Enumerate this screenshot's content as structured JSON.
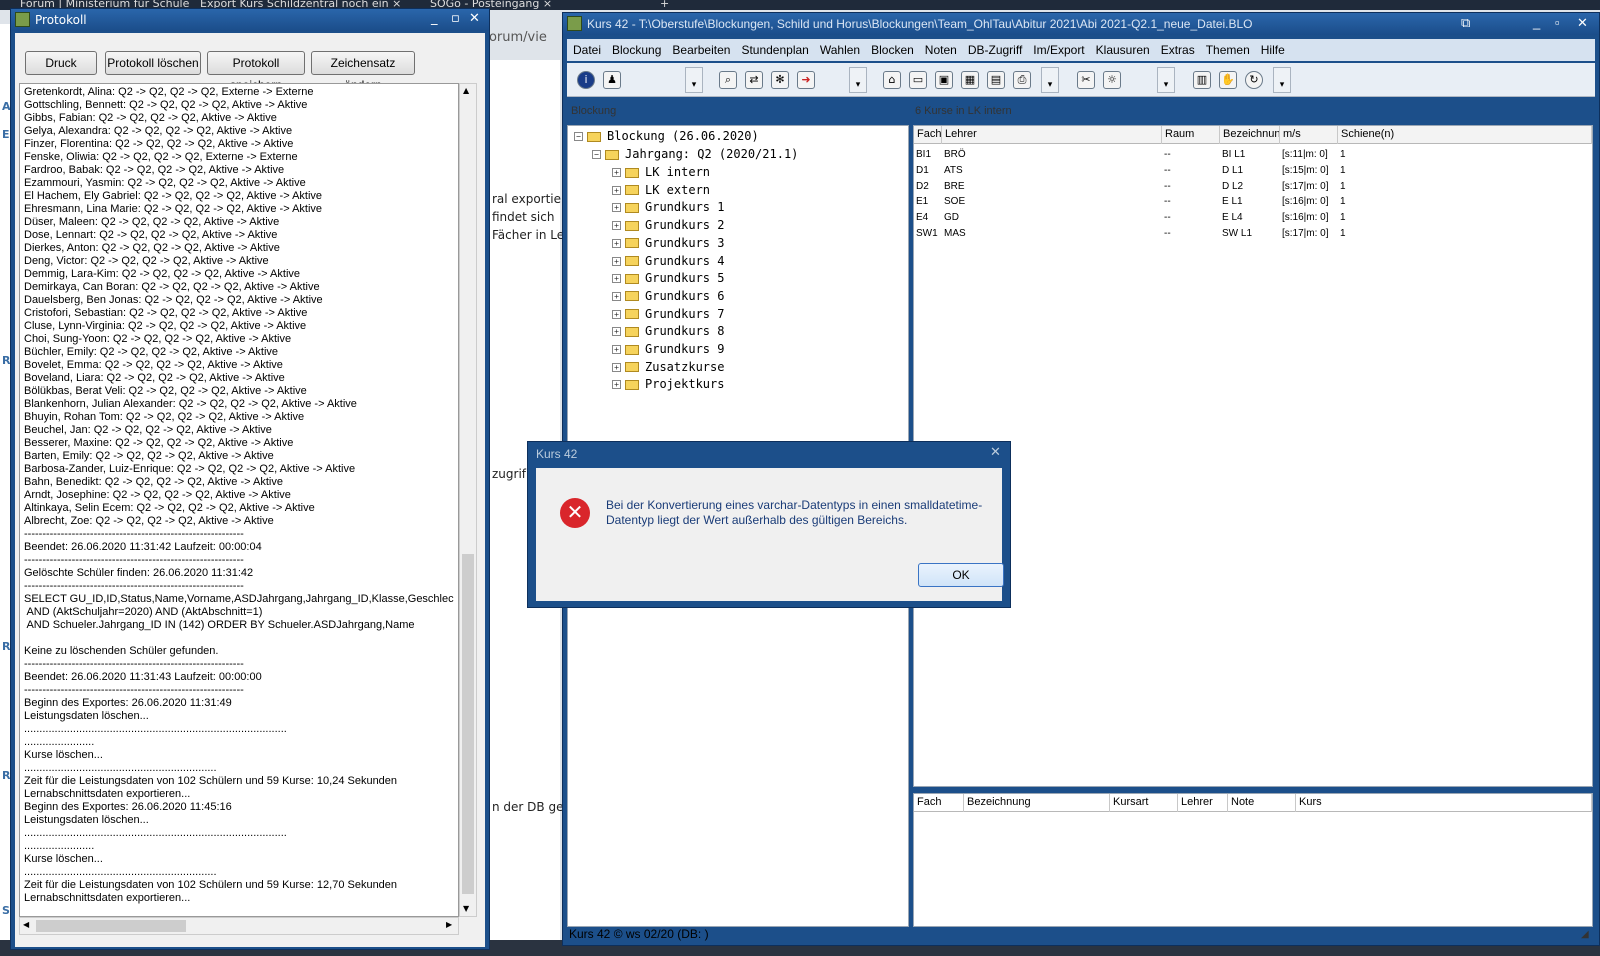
{
  "browser": {
    "tabs": [
      "Forum | Ministerium für Schule ×",
      "Export Kurs Schildzentral noch ein ×",
      "SOGo - Posteingang ×",
      "+"
    ],
    "address_fragment": "/forum/vie",
    "page_lines": [
      "ral exportie",
      "findet sich",
      "Fächer in Le",
      "zugrif",
      "n der DB ge"
    ],
    "left_letters": [
      "A",
      "E",
      "R",
      "R",
      "R",
      "S"
    ]
  },
  "protokoll": {
    "title": "Protokoll",
    "buttons": {
      "druck": "Druck",
      "loeschen": "Protokoll löschen",
      "speichern": "Protokoll speichern",
      "zeichensatz": "Zeichensatz ändern"
    },
    "lines": [
      "Gretenkordt, Alina: Q2 -> Q2, Q2 -> Q2, Externe -> Externe",
      "Gottschling, Bennett: Q2 -> Q2, Q2 -> Q2, Aktive -> Aktive",
      "Gibbs, Fabian: Q2 -> Q2, Q2 -> Q2, Aktive -> Aktive",
      "Gelya, Alexandra: Q2 -> Q2, Q2 -> Q2, Aktive -> Aktive",
      "Finzer, Florentina: Q2 -> Q2, Q2 -> Q2, Aktive -> Aktive",
      "Fenske, Oliwia: Q2 -> Q2, Q2 -> Q2, Externe -> Externe",
      "Fardroo, Babak: Q2 -> Q2, Q2 -> Q2, Aktive -> Aktive",
      "Ezammouri, Yasmin: Q2 -> Q2, Q2 -> Q2, Aktive -> Aktive",
      "El Hachem, Ely Gabriel: Q2 -> Q2, Q2 -> Q2, Aktive -> Aktive",
      "Ehresmann, Lina Marie: Q2 -> Q2, Q2 -> Q2, Aktive -> Aktive",
      "Düser, Maleen: Q2 -> Q2, Q2 -> Q2, Aktive -> Aktive",
      "Dose, Lennart: Q2 -> Q2, Q2 -> Q2, Aktive -> Aktive",
      "Dierkes, Anton: Q2 -> Q2, Q2 -> Q2, Aktive -> Aktive",
      "Deng, Victor: Q2 -> Q2, Q2 -> Q2, Aktive -> Aktive",
      "Demmig, Lara-Kim: Q2 -> Q2, Q2 -> Q2, Aktive -> Aktive",
      "Demirkaya, Can Boran: Q2 -> Q2, Q2 -> Q2, Aktive -> Aktive",
      "Dauelsberg, Ben Jonas: Q2 -> Q2, Q2 -> Q2, Aktive -> Aktive",
      "Cristofori, Sebastian: Q2 -> Q2, Q2 -> Q2, Aktive -> Aktive",
      "Cluse, Lynn-Virginia: Q2 -> Q2, Q2 -> Q2, Aktive -> Aktive",
      "Choi, Sung-Yoon: Q2 -> Q2, Q2 -> Q2, Aktive -> Aktive",
      "Büchler, Emily: Q2 -> Q2, Q2 -> Q2, Aktive -> Aktive",
      "Bovelet, Emma: Q2 -> Q2, Q2 -> Q2, Aktive -> Aktive",
      "Boveland, Liara: Q2 -> Q2, Q2 -> Q2, Aktive -> Aktive",
      "Bölükbas, Berat Veli: Q2 -> Q2, Q2 -> Q2, Aktive -> Aktive",
      "Blankenhorn, Julian Alexander: Q2 -> Q2, Q2 -> Q2, Aktive -> Aktive",
      "Bhuyin, Rohan Tom: Q2 -> Q2, Q2 -> Q2, Aktive -> Aktive",
      "Beuchel, Jan: Q2 -> Q2, Q2 -> Q2, Aktive -> Aktive",
      "Besserer, Maxine: Q2 -> Q2, Q2 -> Q2, Aktive -> Aktive",
      "Barten, Emily: Q2 -> Q2, Q2 -> Q2, Aktive -> Aktive",
      "Barbosa-Zander, Luiz-Enrique: Q2 -> Q2, Q2 -> Q2, Aktive -> Aktive",
      "Bahn, Benedikt: Q2 -> Q2, Q2 -> Q2, Aktive -> Aktive",
      "Arndt, Josephine: Q2 -> Q2, Q2 -> Q2, Aktive -> Aktive",
      "Altinkaya, Selin Ecem: Q2 -> Q2, Q2 -> Q2, Aktive -> Aktive",
      "Albrecht, Zoe: Q2 -> Q2, Q2 -> Q2, Aktive -> Aktive",
      "------------------------------------------------------------",
      "Beendet: 26.06.2020 11:31:42 Laufzeit: 00:00:04",
      "------------------------------------------------------------",
      "Gelöschte Schüler finden: 26.06.2020 11:31:42",
      "------------------------------------------------------------",
      "SELECT GU_ID,ID,Status,Name,Vorname,ASDJahrgang,Jahrgang_ID,Klasse,Geschlecht,Gebu",
      " AND (AktSchuljahr=2020) AND (AktAbschnitt=1)",
      " AND Schueler.Jahrgang_ID IN (142) ORDER BY Schueler.ASDJahrgang,Name",
      "",
      "Keine zu löschenden Schüler gefunden.",
      "------------------------------------------------------------",
      "Beendet: 26.06.2020 11:31:43 Laufzeit: 00:00:00",
      "------------------------------------------------------------",
      "Beginn des Exportes: 26.06.2020 11:31:49",
      "Leistungsdaten löschen...",
      "......................................................................................",
      ".......................",
      "Kurse löschen...",
      "...............................................................",
      "Zeit für die Leistungsdaten von 102 Schülern und 59 Kurse: 10,24 Sekunden",
      "Lernabschnittsdaten exportieren...",
      "Beginn des Exportes: 26.06.2020 11:45:16",
      "Leistungsdaten löschen...",
      "......................................................................................",
      ".......................",
      "Kurse löschen...",
      "...............................................................",
      "Zeit für die Leistungsdaten von 102 Schülern und 59 Kurse: 12,70 Sekunden",
      "Lernabschnittsdaten exportieren..."
    ]
  },
  "kurs": {
    "title": "Kurs 42 - T:\\Oberstufe\\Blockungen, Schild und Horus\\Blockungen\\Team_OhlTau\\Abitur 2021\\Abi 2021-Q2.1_neue_Datei.BLO",
    "menu": [
      "Datei",
      "Blockung",
      "Bearbeiten",
      "Stundenplan",
      "Wahlen",
      "Blocken",
      "Noten",
      "DB-Zugriff",
      "Im/Export",
      "Klausuren",
      "Extras",
      "Themen",
      "Hilfe"
    ],
    "tree_header": "Blockung",
    "tree": {
      "root": "Blockung (26.06.2020)",
      "jahrgang": "Jahrgang: Q2 (2020/21.1)",
      "children": [
        "LK intern",
        "LK extern",
        "Grundkurs 1",
        "Grundkurs 2",
        "Grundkurs 3",
        "Grundkurs 4",
        "Grundkurs 5",
        "Grundkurs 6",
        "Grundkurs 7",
        "Grundkurs 8",
        "Grundkurs 9",
        "Zusatzkurse",
        "Projektkurs"
      ]
    },
    "courses_header": "6 Kurse in LK intern",
    "courses_columns": [
      "Fach",
      "Lehrer",
      "Raum",
      "Bezeichnung",
      "m/s",
      "Schiene(n)"
    ],
    "courses": [
      {
        "fach": "BI1",
        "lehrer": "BRÖ",
        "raum": "--",
        "bez": "BI L1",
        "ms": "[s:11|m: 0]",
        "schiene": "1"
      },
      {
        "fach": "D1",
        "lehrer": "ATS",
        "raum": "--",
        "bez": "D L1",
        "ms": "[s:15|m: 0]",
        "schiene": "1"
      },
      {
        "fach": "D2",
        "lehrer": "BRE",
        "raum": "--",
        "bez": "D L2",
        "ms": "[s:17|m: 0]",
        "schiene": "1"
      },
      {
        "fach": "E1",
        "lehrer": "SOE",
        "raum": "--",
        "bez": "E L1",
        "ms": "[s:16|m: 0]",
        "schiene": "1"
      },
      {
        "fach": "E4",
        "lehrer": "GD",
        "raum": "--",
        "bez": "E L4",
        "ms": "[s:16|m: 0]",
        "schiene": "1"
      },
      {
        "fach": "SW1",
        "lehrer": "MAS",
        "raum": "--",
        "bez": "SW L1",
        "ms": "[s:17|m: 0]",
        "schiene": "1"
      }
    ],
    "lower_columns": [
      "Fach",
      "Bezeichnung",
      "Kursart",
      "Lehrer",
      "Note",
      "Kurs"
    ],
    "status": "Kurs 42 © ws 02/20 (DB: )"
  },
  "dialog": {
    "title": "Kurs 42",
    "message": "Bei der Konvertierung eines varchar-Datentyps in einen smalldatetime-Datentyp liegt der Wert außerhalb des gültigen Bereichs.",
    "ok": "OK",
    "icon_glyph": "✕"
  }
}
